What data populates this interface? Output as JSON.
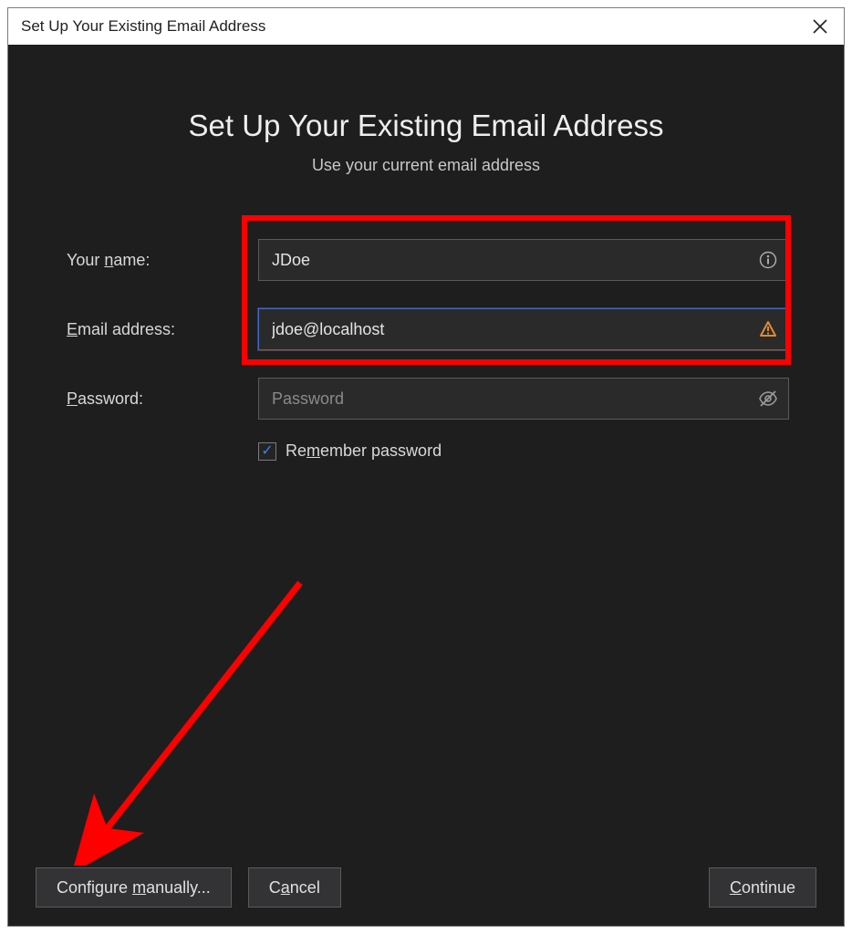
{
  "titlebar": {
    "title": "Set Up Your Existing Email Address"
  },
  "header": {
    "heading": "Set Up Your Existing Email Address",
    "subheading": "Use your current email address"
  },
  "form": {
    "name": {
      "label_pre": "Your ",
      "label_u": "n",
      "label_post": "ame:",
      "value": "JDoe"
    },
    "email": {
      "label_u": "E",
      "label_post": "mail address:",
      "value": "jdoe@localhost"
    },
    "password": {
      "label_u": "P",
      "label_post": "assword:",
      "placeholder": "Password",
      "value": ""
    },
    "remember": {
      "label_pre": "Re",
      "label_u": "m",
      "label_post": "ember password",
      "checked": true
    }
  },
  "buttons": {
    "configure_pre": "Configure ",
    "configure_u": "m",
    "configure_post": "anually...",
    "cancel_pre": "C",
    "cancel_u": "a",
    "cancel_post": "ncel",
    "continue_u": "C",
    "continue_post": "ontinue"
  },
  "annotations": {
    "highlight_box": true,
    "arrow_to_configure": true
  },
  "colors": {
    "accent_red": "#ff0000",
    "check_blue": "#3e7fe6",
    "focus_blue": "#3a6cd4",
    "warn_orange": "#e08b2e"
  }
}
